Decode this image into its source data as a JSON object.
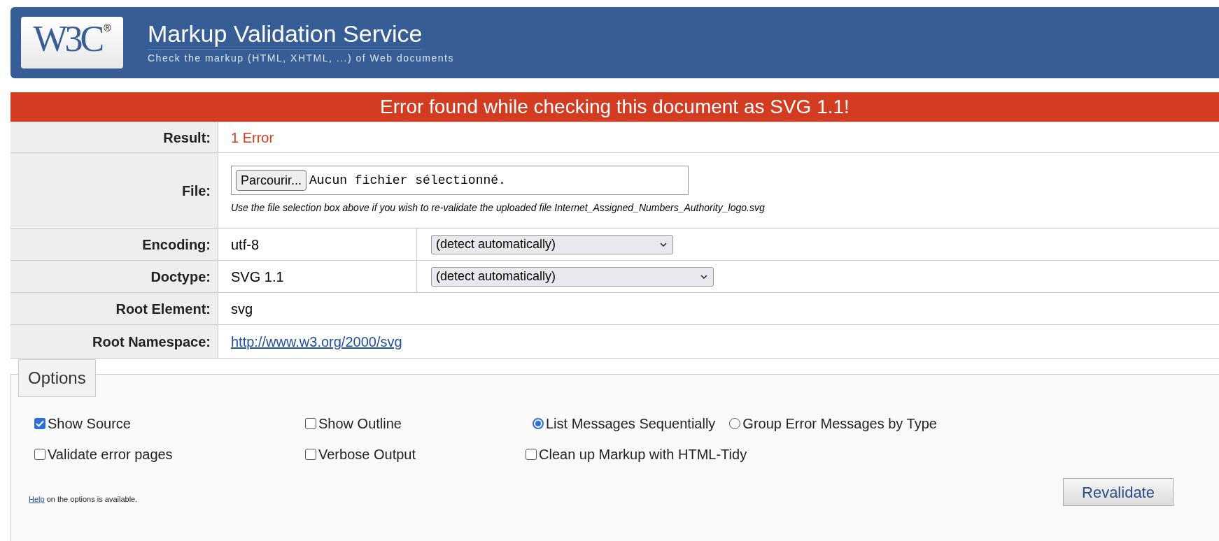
{
  "header": {
    "logo": {
      "text": "W3C",
      "mark": "®"
    },
    "title": "Markup Validation Service",
    "subtitle": "Check the markup (HTML, XHTML, ...) of Web documents"
  },
  "banner": "Error found while checking this document as SVG 1.1!",
  "result_table": [
    {
      "kind": "error",
      "label": "Result:",
      "value": "1 Error"
    },
    {
      "kind": "file",
      "label": "File:",
      "button": "Parcourir...",
      "file_status": "Aucun fichier sélectionné.",
      "note": "Use the file selection box above if you wish to re-validate the uploaded file Internet_Assigned_Numbers_Authority_logo.svg"
    },
    {
      "kind": "select",
      "label": "Encoding:",
      "value": "utf-8",
      "select": "(detect automatically)"
    },
    {
      "kind": "select",
      "label": "Doctype:",
      "value": "SVG 1.1",
      "select": "(detect automatically)"
    },
    {
      "kind": "text",
      "label": "Root Element:",
      "value": "svg"
    },
    {
      "kind": "link",
      "label": "Root Namespace:",
      "value": "http://www.w3.org/2000/svg"
    }
  ],
  "options": {
    "legend": "Options",
    "rows": [
      [
        {
          "kind": "checkbox",
          "label": "Show Source",
          "checked": true
        },
        {
          "kind": "checkbox",
          "label": "Show Outline",
          "checked": false
        },
        {
          "kind": "radio",
          "label": "List Messages Sequentially",
          "selected": true
        },
        {
          "kind": "radio",
          "label": "Group Error Messages by Type",
          "selected": false
        }
      ],
      [
        {
          "kind": "checkbox",
          "label": "Validate error pages",
          "checked": false
        },
        {
          "kind": "checkbox",
          "label": "Verbose Output",
          "checked": false
        },
        {
          "kind": "checkbox",
          "label": "Clean up Markup with HTML-Tidy",
          "checked": false
        }
      ]
    ],
    "help_link": "Help",
    "help_text": "on the options is available.",
    "button": "Revalidate"
  }
}
